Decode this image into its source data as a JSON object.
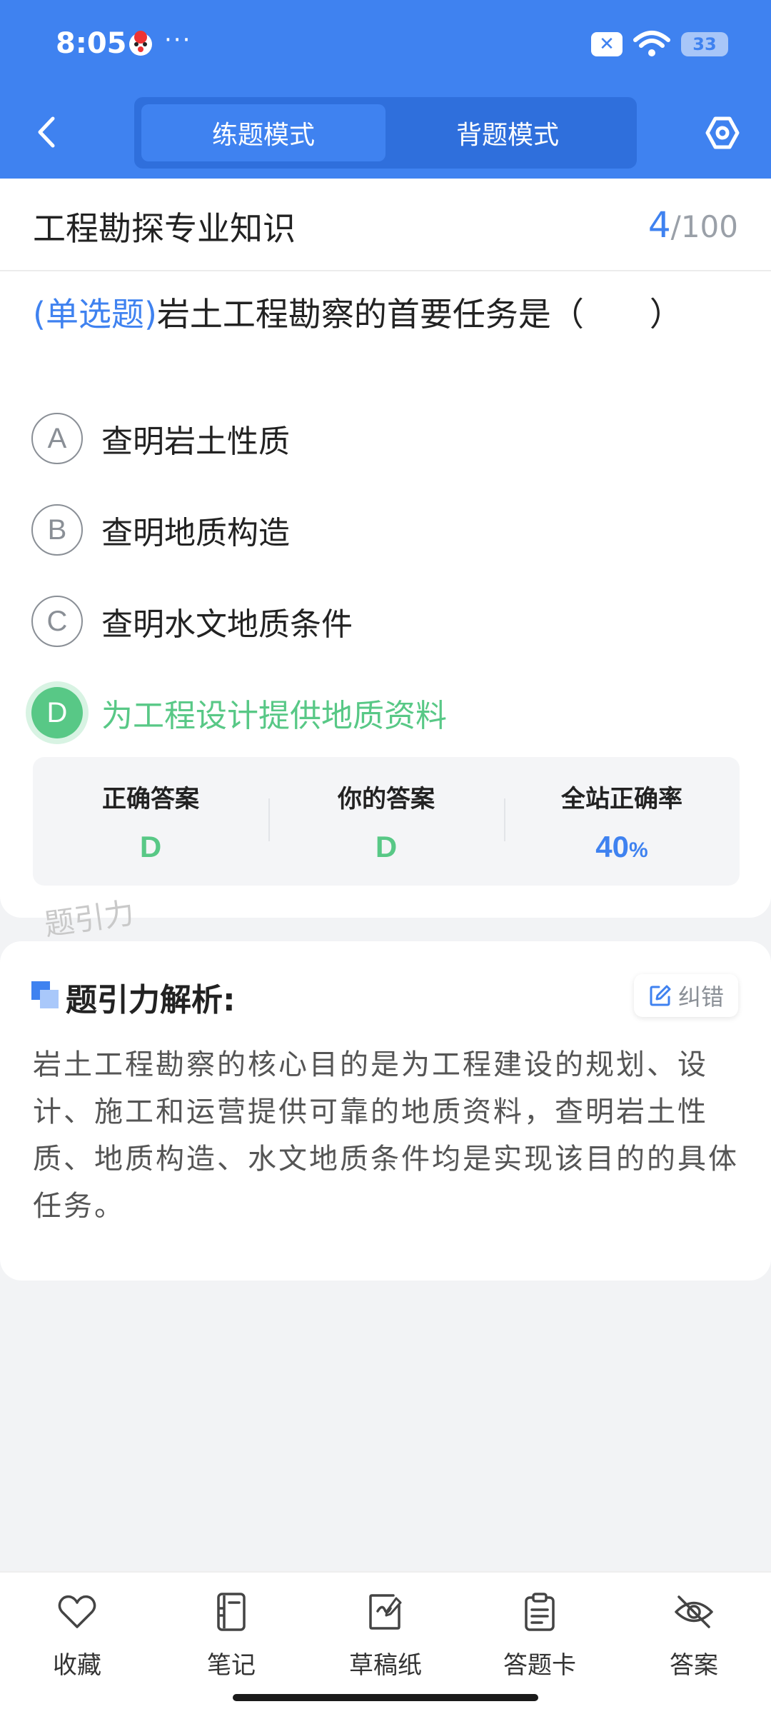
{
  "status_bar": {
    "time": "8:05",
    "dots": "···",
    "battery": "33",
    "close_badge": "✕"
  },
  "header": {
    "tabs": [
      {
        "label": "练题模式",
        "active": true
      },
      {
        "label": "背题模式",
        "active": false
      }
    ]
  },
  "subject": {
    "title": "工程勘探专业知识",
    "current": "4",
    "total": "/100"
  },
  "question": {
    "type": "(单选题)",
    "text": "岩土工程勘察的首要任务是（　　）"
  },
  "options": [
    {
      "letter": "A",
      "text": "查明岩土性质"
    },
    {
      "letter": "B",
      "text": "查明地质构造"
    },
    {
      "letter": "C",
      "text": "查明水文地质条件"
    },
    {
      "letter": "D",
      "text": "为工程设计提供地质资料"
    }
  ],
  "stats": {
    "correct_label": "正确答案",
    "correct_value": "D",
    "yours_label": "你的答案",
    "yours_value": "D",
    "rate_label": "全站正确率",
    "rate_value": "40",
    "rate_unit": "%"
  },
  "watermark": "题引力",
  "analysis": {
    "title": "题引力解析:",
    "report_label": "纠错",
    "text": "岩土工程勘察的核心目的是为工程建设的规划、设计、施工和运营提供可靠的地质资料，查明岩土性质、地质构造、水文地质条件均是实现该目的的具体任务。"
  },
  "toolbar": {
    "items": [
      {
        "label": "收藏",
        "icon": "heart-icon"
      },
      {
        "label": "笔记",
        "icon": "notebook-icon"
      },
      {
        "label": "草稿纸",
        "icon": "draft-icon"
      },
      {
        "label": "答题卡",
        "icon": "clipboard-icon"
      },
      {
        "label": "答案",
        "icon": "eye-off-icon"
      }
    ]
  },
  "colors": {
    "primary": "#3f82f0",
    "correct": "#58c886",
    "background": "#f2f3f5"
  }
}
